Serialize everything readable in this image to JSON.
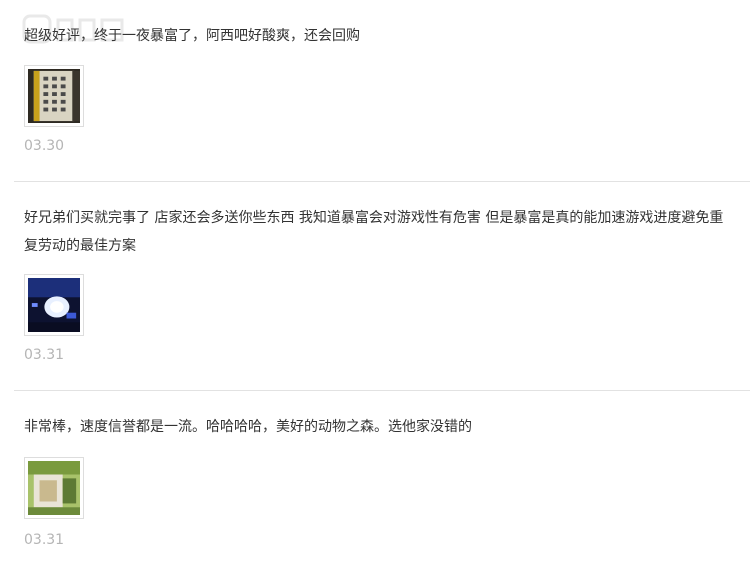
{
  "reviews": [
    {
      "text": "超级好评，终于一夜暴富了，阿西吧好酸爽，还会回购",
      "date": "03.30",
      "photo_icon": "calculator-keypad-photo-icon"
    },
    {
      "text": "好兄弟们买就完事了 店家还会多送你些东西 我知道暴富会对游戏性有危害 但是暴富是真的能加速游戏进度避免重复劳动的最佳方案",
      "date": "03.31",
      "photo_icon": "game-screen-photo-icon"
    },
    {
      "text": "非常棒，速度信誉都是一流。哈哈哈哈，美好的动物之森。选他家没错的",
      "date": "03.31",
      "photo_icon": "console-photo-icon"
    }
  ],
  "colors": {
    "text": "#333333",
    "date": "#b5b5b5",
    "divider": "#e2e2e2"
  }
}
